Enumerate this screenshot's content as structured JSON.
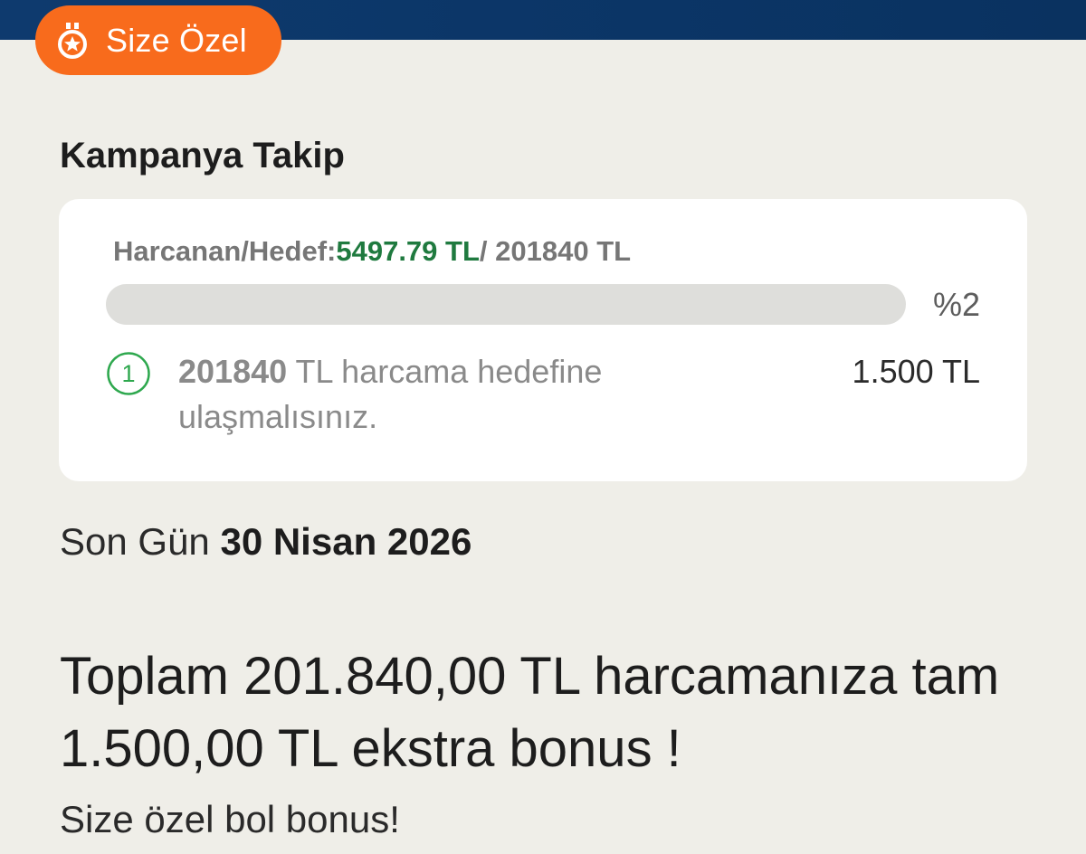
{
  "badge": {
    "label": "Size Özel",
    "icon": "medal-star-icon"
  },
  "section": {
    "title": "Kampanya Takip"
  },
  "card": {
    "spent_prefix": "Harcanan/Hedef:",
    "spent_value": "5497.79 TL",
    "target_suffix": "/ 201840 TL",
    "progress_fraction": 0.02,
    "percent_label": "%2",
    "step": {
      "number": "1",
      "target_value": "201840",
      "text_rest": " TL harcama hedefine ulaşmalısınız.",
      "reward": "1.500 TL"
    }
  },
  "deadline": {
    "label": "Son Gün ",
    "date": "30 Nisan 2026"
  },
  "promo": {
    "headline": "Toplam 201.840,00 TL harcamanıza tam 1.500,00 TL ekstra bonus !",
    "subline": "Size özel bol bonus!"
  },
  "colors": {
    "accent_orange": "#f86b1c",
    "success_green": "#1f7a3f",
    "step_green": "#2ea84e",
    "header_blue": "#0b3566",
    "background": "#efeee8"
  }
}
